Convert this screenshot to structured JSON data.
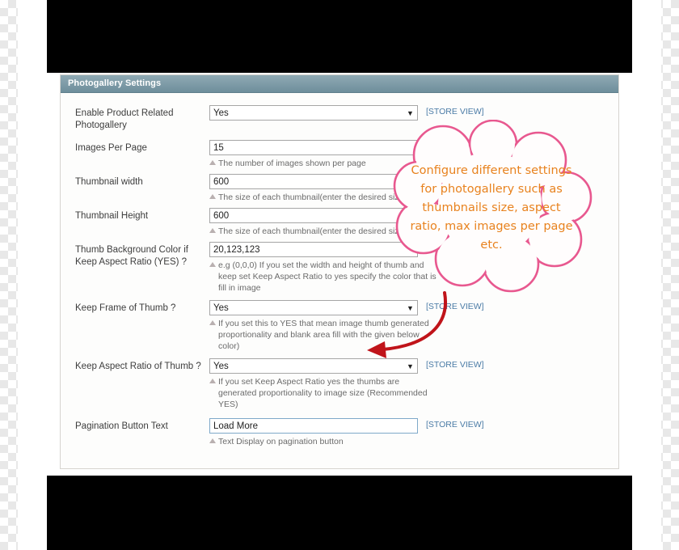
{
  "panel": {
    "title": "Photogallery Settings",
    "store_view_label": "[STORE VIEW]",
    "fields": [
      {
        "label": "Enable Product Related Photogallery",
        "type": "select",
        "value": "Yes",
        "hint": "",
        "store_view": "[STORE VIEW]"
      },
      {
        "label": "Images Per Page",
        "type": "input",
        "value": "15",
        "hint": "The number of images shown per page",
        "store_view": ""
      },
      {
        "label": "Thumbnail width",
        "type": "input",
        "value": "600",
        "hint": "The size of each thumbnail(enter the desired size)",
        "store_view": ""
      },
      {
        "label": "Thumbnail Height",
        "type": "input",
        "value": "600",
        "hint": "The size of each thumbnail(enter the desired size)",
        "store_view": ""
      },
      {
        "label": "Thumb Background Color if Keep Aspect Ratio (YES) ?",
        "type": "input",
        "value": "20,123,123",
        "hint": "e.g (0,0,0) If you set the width and height of thumb and keep set Keep Aspect Ratio to yes specify the color that is fill in image",
        "store_view": ""
      },
      {
        "label": "Keep Frame of Thumb ?",
        "type": "select",
        "value": "Yes",
        "hint": "If you set this to YES that mean image thumb generated proportionality and blank area fill with the given below color)",
        "store_view": "[STORE VIEW]"
      },
      {
        "label": "Keep Aspect Ratio of Thumb ?",
        "type": "select",
        "value": "Yes",
        "hint": "If you set Keep Aspect Ratio yes the thumbs are generated proportionality to image size (Recommended YES)",
        "store_view": "[STORE VIEW]"
      },
      {
        "label": "Pagination Button Text",
        "type": "input",
        "value": "Load More",
        "hint": "Text Display on pagination button",
        "store_view": "[STORE VIEW]"
      }
    ]
  },
  "callout": {
    "text": "Configure different settings for photogallery such as thumbnails size, aspect ratio, max images per page etc.",
    "text_color": "#e8821e",
    "border_color": "#e8588f",
    "fill_color": "#fffdfd",
    "arrow_color": "#c0141a"
  },
  "icons": {
    "select_arrow": "▼",
    "hint_marker": "hint-triangle-icon"
  }
}
